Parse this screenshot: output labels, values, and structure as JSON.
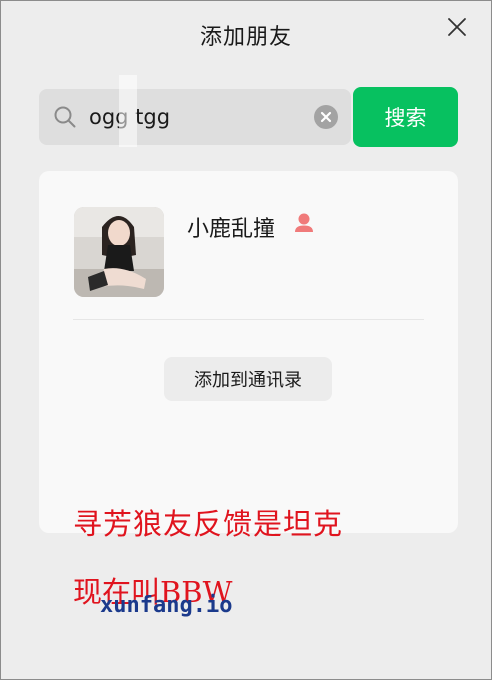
{
  "window": {
    "title": "添加朋友",
    "close_icon": "close-icon"
  },
  "search": {
    "query": "ogg tgg",
    "search_icon": "search-icon",
    "clear_icon": "clear-circle-icon",
    "button_label": "搜索"
  },
  "result": {
    "name": "小鹿乱撞",
    "gender_icon": "female-user-icon",
    "add_button_label": "添加到通讯录"
  },
  "watermark": {
    "line1": "寻芳狼友反馈是坦克",
    "line2": "现在叫BBW",
    "site": "xunfang.io"
  },
  "colors": {
    "accent": "#07c160",
    "gender_icon": "#f07a7a",
    "watermark_red": "#e0141e",
    "watermark_blue": "#1b3a8c"
  }
}
